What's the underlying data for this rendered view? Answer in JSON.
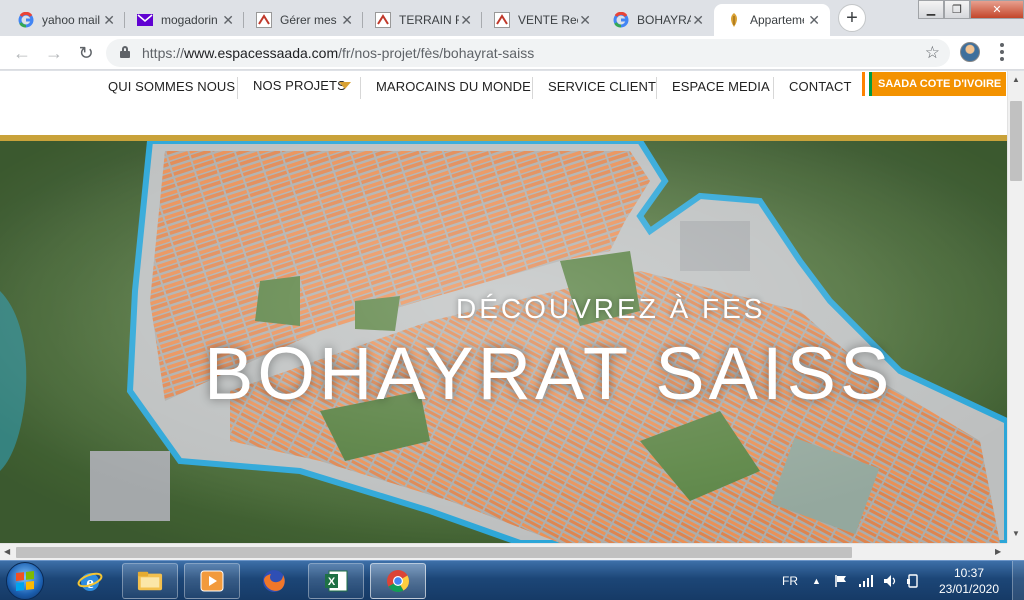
{
  "browser": {
    "tabs": [
      {
        "title": "yahoo mail - Recherche Google",
        "icon": "google-icon",
        "active": false
      },
      {
        "title": "mogadorin - Yahoo Mail",
        "icon": "mail-icon",
        "active": false
      },
      {
        "title": "Gérer mes annonces",
        "icon": "site-icon",
        "active": false
      },
      {
        "title": "TERRAIN FES",
        "icon": "site-icon",
        "active": false
      },
      {
        "title": "VENTE Recherche",
        "icon": "site-icon",
        "active": false
      },
      {
        "title": "BOHAYRAT SAISS - Recherche Google",
        "icon": "google-icon",
        "active": false
      },
      {
        "title": "Appartement",
        "icon": "saada-icon",
        "active": true
      }
    ],
    "url_prefix": "https://",
    "url_host": "www.espacessaada.com",
    "url_path": "/fr/nos-projet/fès/bohayrat-saiss",
    "colors": {
      "accent": "#1a73e8"
    }
  },
  "site": {
    "nav": {
      "items": [
        "QUI SOMMES NOUS",
        "NOS PROJETS",
        "MAROCAINS DU MONDE",
        "SERVICE CLIENT",
        "ESPACE MEDIA",
        "CONTACT"
      ],
      "cta_label": "SAADA COTE D'IVOIRE"
    },
    "colors": {
      "gold": "#c9a23a",
      "orange": "#f39200"
    },
    "hero": {
      "subtitle": "DÉCOUVREZ À FES",
      "title": "BOHAYRAT SAISS"
    }
  },
  "taskbar": {
    "apps": [
      {
        "name": "internet-explorer-icon",
        "glyph": "e"
      },
      {
        "name": "file-explorer-icon",
        "glyph": ""
      },
      {
        "name": "media-player-icon",
        "glyph": "▶"
      },
      {
        "name": "firefox-icon",
        "glyph": ""
      },
      {
        "name": "excel-icon",
        "glyph": "X"
      },
      {
        "name": "chrome-icon",
        "glyph": ""
      }
    ],
    "language": "FR",
    "time": "10:37",
    "date": "23/01/2020"
  }
}
